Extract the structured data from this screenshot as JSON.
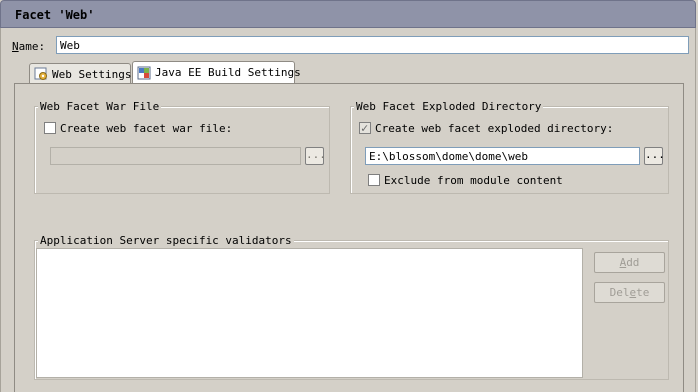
{
  "window": {
    "title": "Facet 'Web'"
  },
  "name_field": {
    "label_mnemonic": "N",
    "label_rest": "ame:",
    "value": "Web"
  },
  "tabs": [
    {
      "label": "Web Settings",
      "icon": "web-settings-icon",
      "active": false
    },
    {
      "label": "Java EE Build Settings",
      "icon": "java-ee-build-icon",
      "active": true
    }
  ],
  "war_group": {
    "title": "Web Facet War File",
    "checkbox_label": "Create web facet war file:",
    "checked": false,
    "path": "",
    "browse_label": "..."
  },
  "exploded_group": {
    "title": "Web Facet Exploded Directory",
    "checkbox_label": "Create web facet exploded directory:",
    "checked": true,
    "path": "E:\\blossom\\dome\\dome\\web",
    "browse_label": "...",
    "exclude_label": "Exclude from module content",
    "exclude_checked": false
  },
  "validators_group": {
    "title": "Application Server specific validators",
    "add_mnemonic": "A",
    "add_rest": "dd",
    "delete_pre": "Del",
    "delete_mnemonic": "e",
    "delete_post": "te"
  },
  "colors": {
    "titlebar": "#8f93a8",
    "background": "#d4d0c8",
    "field_border": "#7f9db9"
  }
}
